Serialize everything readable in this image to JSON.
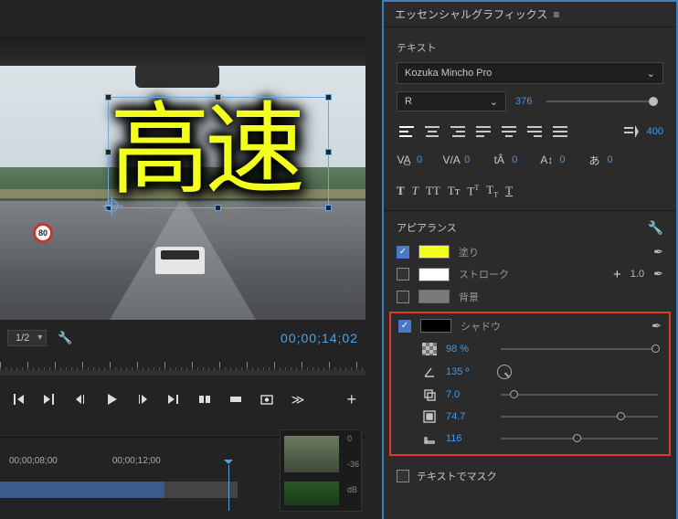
{
  "panel": {
    "title": "エッセンシャルグラフィックス"
  },
  "text_section": {
    "label": "テキスト",
    "font": "Kozuka Mincho Pro",
    "weight": "R",
    "size": 376,
    "indent_value": 400,
    "metrics": {
      "va_caps": 0,
      "va": 0,
      "baseline": 0,
      "aa": 0,
      "tsume": 0
    }
  },
  "appearance": {
    "label": "アピアランス",
    "fill": {
      "enabled": true,
      "label": "塗り",
      "color": "#f3ff1c"
    },
    "stroke": {
      "enabled": false,
      "label": "ストローク",
      "width": "1.0",
      "color": "#ffffff"
    },
    "bg": {
      "enabled": false,
      "label": "背景",
      "color": "#7a7a7a"
    },
    "shadow": {
      "enabled": true,
      "label": "シャドウ",
      "color": "#000000",
      "opacity": "98 %",
      "angle": "135 º",
      "distance": "7.0",
      "size": "74.7",
      "blur": "116"
    }
  },
  "mask": {
    "label": "テキストでマスク"
  },
  "monitor": {
    "zoom": "1/2",
    "timecode": "00;00;14;02",
    "overlay_text": "高速",
    "sign_text": "80",
    "timeline_labels": [
      "00;00;08;00",
      "00;00;12;00"
    ],
    "db_labels": [
      "0",
      "-36",
      "dB"
    ]
  }
}
